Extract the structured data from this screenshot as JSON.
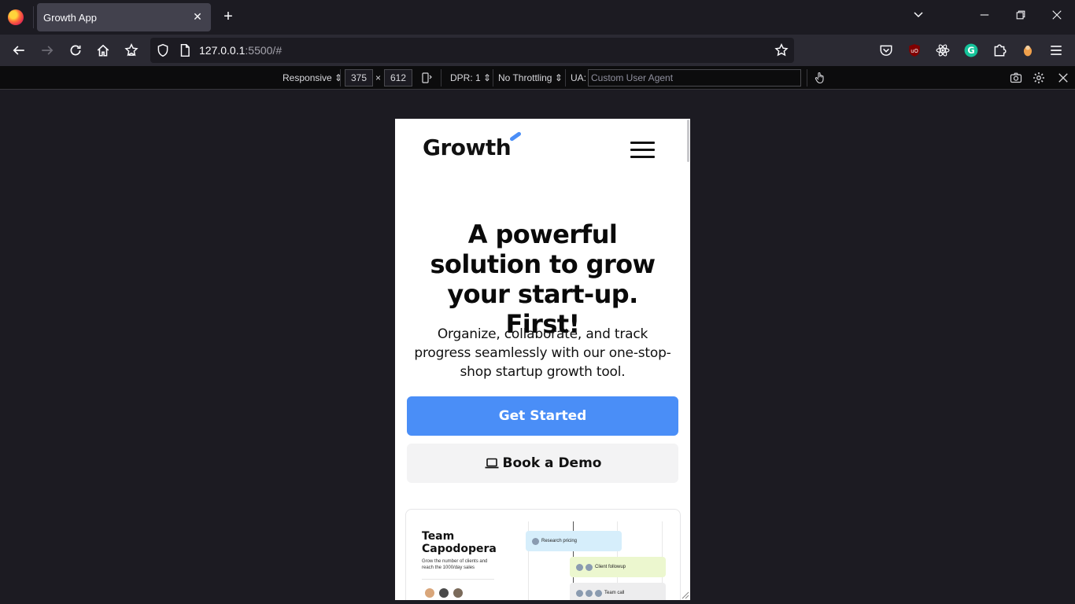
{
  "browser": {
    "tab_title": "Growth App",
    "tab_close": "✕",
    "new_tab": "+",
    "url_host": "127.0.0.1",
    "url_rest": ":5500/#"
  },
  "rdm": {
    "device": "Responsive",
    "width": "375",
    "times": "×",
    "height": "612",
    "dpr": "DPR: 1",
    "throttling": "No Throttling",
    "ua_label": "UA:",
    "ua_placeholder": "Custom User Agent"
  },
  "page": {
    "brand": "Growth",
    "hero_title": "A powerful solution to grow your start-up. First!",
    "hero_subtitle": "Organize, collaborate, and track progress seamlessly with our one-stop-shop startup growth tool.",
    "primary_cta": "Get Started",
    "secondary_cta": "Book a Demo",
    "preview": {
      "team_name": "Team Capodopera",
      "team_desc": "Grow the number of clients and reach the 1000/day sales",
      "tasks": [
        "Research pricing",
        "Client followup",
        "Team call"
      ]
    }
  },
  "colors": {
    "accent": "#4a8ef7",
    "browser_bg": "#1c1b22",
    "toolbar_bg": "#2b2a33"
  }
}
